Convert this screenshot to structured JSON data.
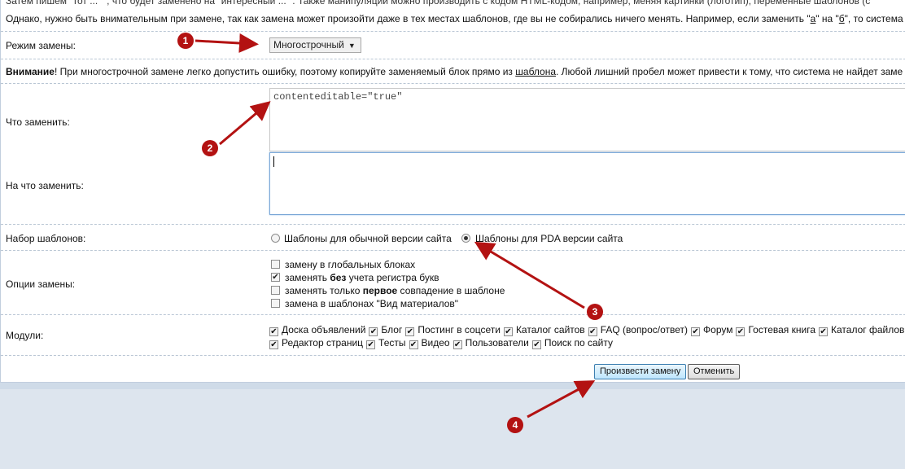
{
  "intro_partial": "Затем пишем  \"тот ... \" , что будет заменено на \"интересный ... \". Также манипуляции можно производить с кодом HTML-кодом, например, меняя картинки (логотип), переменные шаблонов (с",
  "info_line": {
    "before": "Однако, нужно быть внимательным при замене, так как замена может произойти даже в тех местах шаблонов, где вы не собирались ничего менять. Например, если заменить \"",
    "a": "а",
    "mid": "\" на \"",
    "b": "б",
    "after": "\", то система з"
  },
  "mode": {
    "label": "Режим замены:",
    "value": "Многострочный",
    "arrow": "▼"
  },
  "warning": {
    "bold": "Внимание",
    "text1": "! При многострочной замене легко допустить ошибку, поэтому копируйте заменяемый блок прямо из ",
    "link": "шаблона",
    "text2": ". Любой лишний пробел может привести к тому, что система не найдет заме"
  },
  "find": {
    "label": "Что заменить:",
    "value": "contenteditable=\"true\""
  },
  "replace": {
    "label": "На что заменить:",
    "value": ""
  },
  "templates": {
    "label": "Набор шаблонов:",
    "options": [
      "Шаблоны для обычной версии сайта",
      "Шаблоны для PDA версии сайта"
    ],
    "selected": 1
  },
  "options": {
    "label": "Опции замены:",
    "items": [
      {
        "pre": "замену в глобальных блоках",
        "bold": "",
        "post": "",
        "checked": false
      },
      {
        "pre": "заменять ",
        "bold": "без",
        "post": " учета регистра букв",
        "checked": true
      },
      {
        "pre": "заменять только ",
        "bold": "первое",
        "post": " совпадение в шаблоне",
        "checked": false
      },
      {
        "pre": "замена в шаблонах \"Вид материалов\"",
        "bold": "",
        "post": "",
        "checked": false
      }
    ]
  },
  "modules": {
    "label": "Модули:",
    "row1": [
      "Доска объявлений",
      "Блог",
      "Постинг в соцсети",
      "Каталог сайтов",
      "FAQ (вопрос/ответ)",
      "Форум",
      "Гостевая книга",
      "Каталог файлов"
    ],
    "row2": [
      "Редактор страниц",
      "Тесты",
      "Видео",
      "Пользователи",
      "Поиск по сайту"
    ]
  },
  "buttons": {
    "submit": "Произвести замену",
    "cancel": "Отменить"
  },
  "check_mark": "✔",
  "annotations": [
    "1",
    "2",
    "3",
    "4"
  ],
  "accent": "#b31212"
}
